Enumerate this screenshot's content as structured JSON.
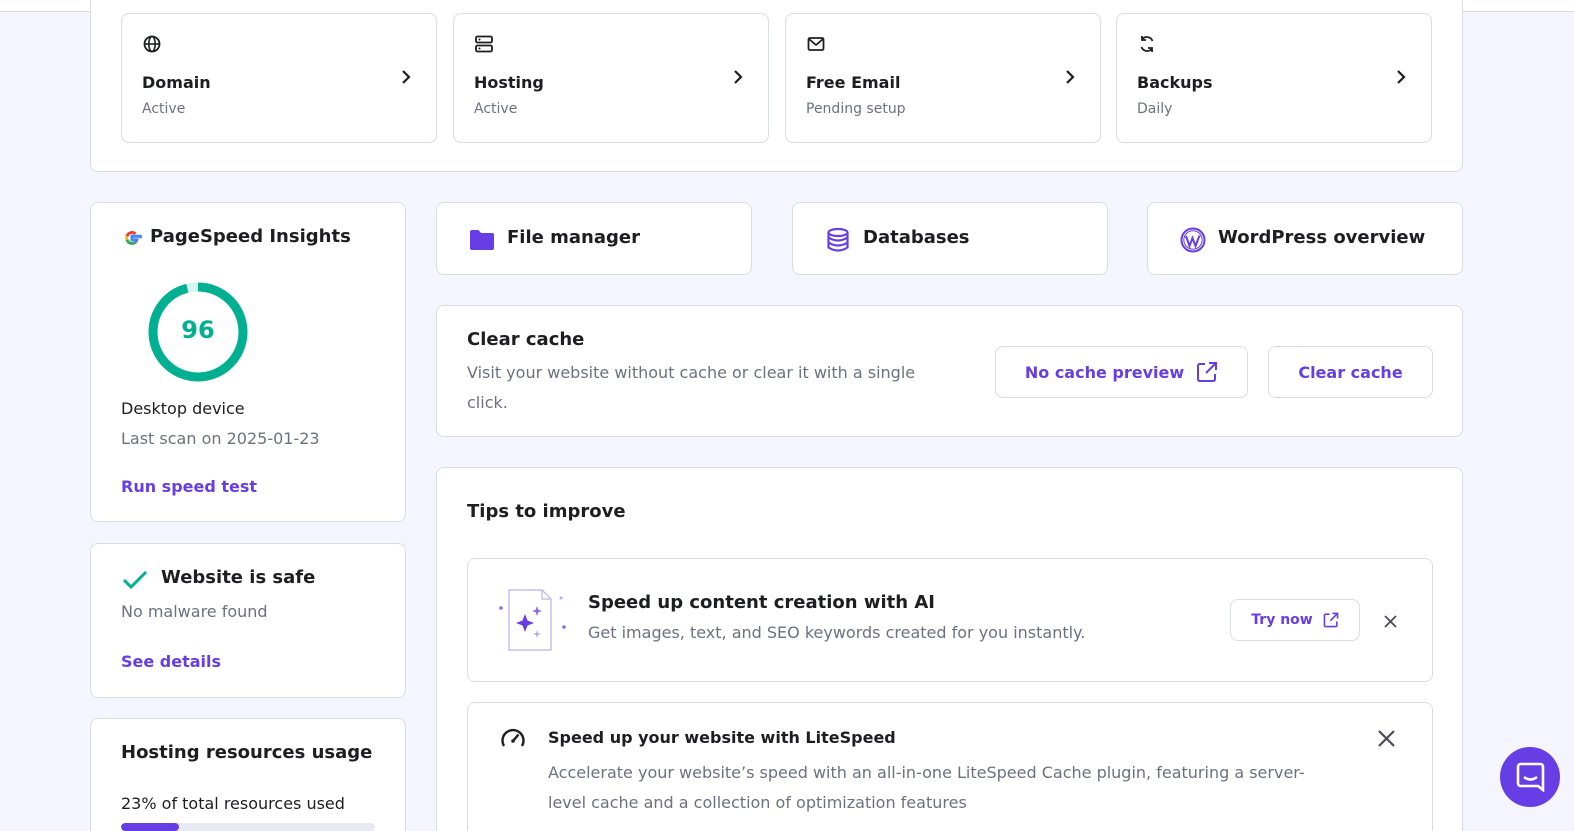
{
  "status_tiles": [
    {
      "title": "Domain",
      "subtitle": "Active",
      "icon": "globe-icon"
    },
    {
      "title": "Hosting",
      "subtitle": "Active",
      "icon": "server-icon"
    },
    {
      "title": "Free Email",
      "subtitle": "Pending setup",
      "icon": "mail-icon"
    },
    {
      "title": "Backups",
      "subtitle": "Daily",
      "icon": "refresh-icon"
    }
  ],
  "pagespeed": {
    "title": "PageSpeed Insights",
    "score": "96",
    "score_fraction": 0.96,
    "device": "Desktop device",
    "last_scan": "Last scan on 2025-01-23",
    "run_label": "Run speed test"
  },
  "security": {
    "title": "Website is safe",
    "subtitle": "No malware found",
    "details_label": "See details"
  },
  "resources": {
    "title": "Hosting resources usage",
    "usage_text": "23% of total resources used",
    "usage_fraction": 0.23
  },
  "quick_links": [
    {
      "label": "File manager",
      "icon": "folder-icon"
    },
    {
      "label": "Databases",
      "icon": "database-icon"
    },
    {
      "label": "WordPress overview",
      "icon": "wordpress-icon"
    }
  ],
  "cache": {
    "title": "Clear cache",
    "description": "Visit your website without cache or clear it with a single click.",
    "preview_label": "No cache preview",
    "clear_label": "Clear cache"
  },
  "tips": {
    "title": "Tips to improve",
    "items": [
      {
        "title": "Speed up content creation with AI",
        "description": "Get images, text, and SEO keywords created for you instantly.",
        "action_label": "Try now"
      },
      {
        "title": "Speed up your website with LiteSpeed",
        "description": "Accelerate your website’s speed with an all-in-one LiteSpeed Cache plugin, featuring a server-level cache and a collection of optimization features"
      }
    ]
  },
  "colors": {
    "accent": "#673de6",
    "success": "#00b090",
    "muted": "#6d7081",
    "background": "#f4f5ff"
  }
}
